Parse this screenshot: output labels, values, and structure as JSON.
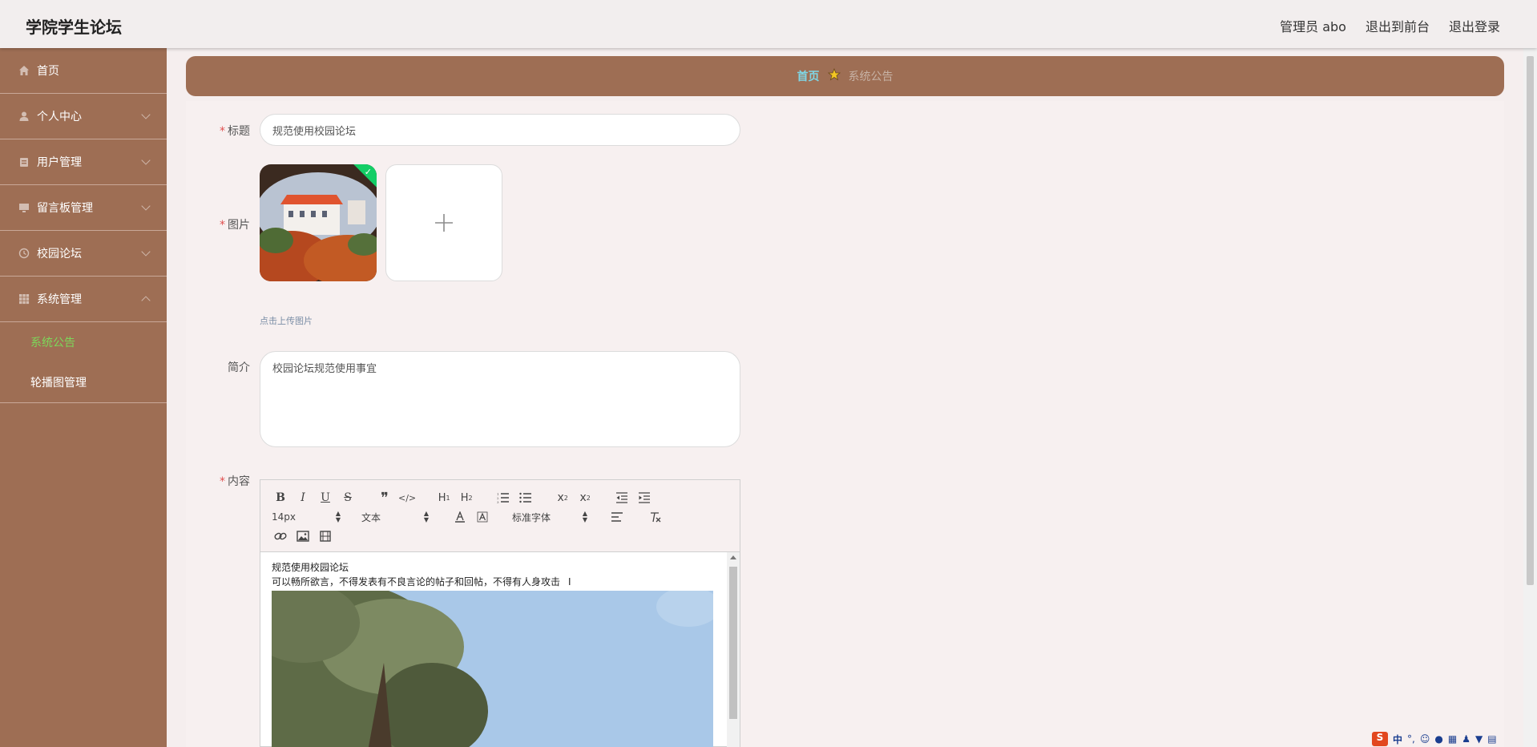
{
  "header": {
    "title": "学院学生论坛",
    "admin_label": "管理员 abo",
    "to_front_label": "退出到前台",
    "logout_label": "退出登录"
  },
  "sidebar": {
    "items": [
      {
        "label": "首页",
        "icon": "home-icon"
      },
      {
        "label": "个人中心",
        "icon": "user-icon"
      },
      {
        "label": "用户管理",
        "icon": "users-icon"
      },
      {
        "label": "留言板管理",
        "icon": "monitor-icon"
      },
      {
        "label": "校园论坛",
        "icon": "clock-icon"
      },
      {
        "label": "系统管理",
        "icon": "grid-icon"
      }
    ],
    "sub_items": [
      {
        "label": "系统公告",
        "active": true
      },
      {
        "label": "轮播图管理",
        "active": false
      }
    ]
  },
  "breadcrumb": {
    "home": "首页",
    "current": "系统公告"
  },
  "form": {
    "title_label": "标题",
    "title_value": "规范使用校园论坛",
    "image_label": "图片",
    "upload_hint": "点击上传图片",
    "intro_label": "简介",
    "intro_value": "校园论坛规范使用事宜",
    "content_label": "内容"
  },
  "editor": {
    "font_size": "14px",
    "header_select": "文本",
    "font_family": "标准字体",
    "line1": "规范使用校园论坛",
    "line2": "可以畅所欲言，不得发表有不良言论的帖子和回帖，不得有人身攻击"
  },
  "ime": {
    "lang": "中"
  },
  "colors": {
    "sidebar": "#9e6e54",
    "accent_green": "#7cd85a",
    "breadcrumb_home": "#7fd7e6",
    "required": "#e04f4f"
  }
}
